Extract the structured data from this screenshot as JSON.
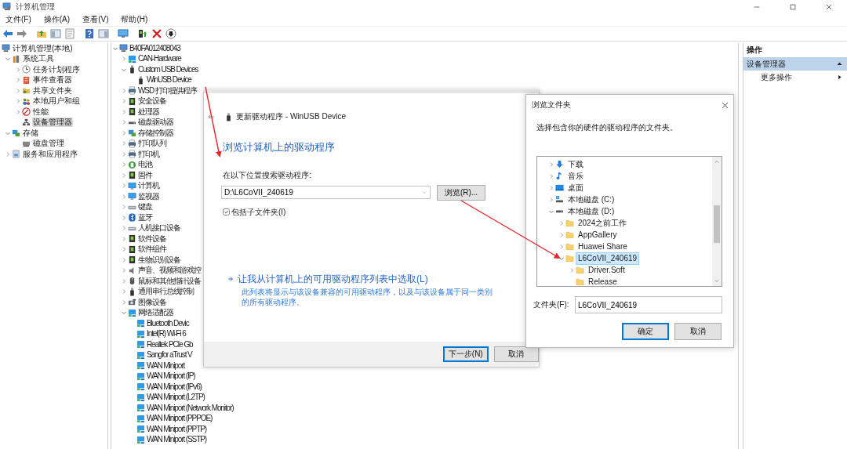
{
  "window": {
    "title": "计算机管理"
  },
  "menu": [
    "文件(F)",
    "操作(A)",
    "查看(V)",
    "帮助(H)"
  ],
  "nav_tree": {
    "label": "计算机管理(本地)",
    "kind": "computer",
    "selected": false,
    "children": [
      {
        "label": "系统工具",
        "kind": "tools",
        "expanded": true,
        "selected": false,
        "children": [
          {
            "label": "任务计划程序",
            "kind": "clock",
            "expanded": false,
            "selected": false
          },
          {
            "label": "事件查看器",
            "kind": "event",
            "expanded": false,
            "selected": false
          },
          {
            "label": "共享文件夹",
            "kind": "share",
            "expanded": false,
            "selected": false
          },
          {
            "label": "本地用户和组",
            "kind": "users",
            "expanded": false,
            "selected": false
          },
          {
            "label": "性能",
            "kind": "perf",
            "expanded": false,
            "selected": false
          },
          {
            "label": "设备管理器",
            "kind": "devmgr",
            "selected": true
          }
        ]
      },
      {
        "label": "存储",
        "kind": "storage",
        "expanded": true,
        "selected": false,
        "children": [
          {
            "label": "磁盘管理",
            "kind": "disk",
            "selected": false
          }
        ]
      },
      {
        "label": "服务和应用程序",
        "kind": "services",
        "expanded": false,
        "selected": false
      }
    ]
  },
  "device_tree": {
    "label": "B40FA012408043",
    "kind": "computer",
    "expanded": true,
    "children": [
      {
        "label": "CAN-Hardware",
        "kind": "network",
        "expanded": false
      },
      {
        "label": "Custom USB Devices",
        "kind": "usb",
        "expanded": true,
        "children": [
          {
            "label": "WinUSB Device",
            "kind": "usb"
          }
        ]
      },
      {
        "label": "WSD 打印提供程序",
        "kind": "printer",
        "expanded": false
      },
      {
        "label": "安全设备",
        "kind": "chip",
        "expanded": false
      },
      {
        "label": "处理器",
        "kind": "chip",
        "expanded": false
      },
      {
        "label": "磁盘驱动器",
        "kind": "drive",
        "expanded": false
      },
      {
        "label": "存储控制器",
        "kind": "storage",
        "expanded": false
      },
      {
        "label": "打印队列",
        "kind": "printer",
        "expanded": false
      },
      {
        "label": "打印机",
        "kind": "printer",
        "expanded": false
      },
      {
        "label": "电池",
        "kind": "battery",
        "expanded": false
      },
      {
        "label": "固件",
        "kind": "chip",
        "expanded": false
      },
      {
        "label": "计算机",
        "kind": "monitor",
        "expanded": false
      },
      {
        "label": "监视器",
        "kind": "monitor",
        "expanded": false
      },
      {
        "label": "键盘",
        "kind": "keyboard",
        "expanded": false
      },
      {
        "label": "蓝牙",
        "kind": "bluetooth",
        "expanded": false
      },
      {
        "label": "人机接口设备",
        "kind": "keyboard",
        "expanded": false
      },
      {
        "label": "软件设备",
        "kind": "chip",
        "expanded": false
      },
      {
        "label": "软件组件",
        "kind": "chip",
        "expanded": false
      },
      {
        "label": "生物识别设备",
        "kind": "chip",
        "expanded": false
      },
      {
        "label": "声音、视频和游戏控",
        "kind": "speaker",
        "expanded": false
      },
      {
        "label": "鼠标和其他指针设备",
        "kind": "mouse",
        "expanded": false
      },
      {
        "label": "通用串行总线控制",
        "kind": "usb",
        "expanded": false
      },
      {
        "label": "图像设备",
        "kind": "camera",
        "expanded": false
      },
      {
        "label": "网络适配器",
        "kind": "network",
        "expanded": true,
        "children": [
          {
            "label": "Bluetooth Devic",
            "kind": "network"
          },
          {
            "label": "Intel(R) Wi-Fi 6",
            "kind": "network"
          },
          {
            "label": "Realtek PCIe Gb",
            "kind": "network"
          },
          {
            "label": "Sangfor aTrust V",
            "kind": "network"
          },
          {
            "label": "WAN Miniport",
            "kind": "network"
          },
          {
            "label": "WAN Miniport (IP)",
            "kind": "network"
          },
          {
            "label": "WAN Miniport (IPv6)",
            "kind": "network"
          },
          {
            "label": "WAN Miniport (L2TP)",
            "kind": "network"
          },
          {
            "label": "WAN Miniport (Network Monitor)",
            "kind": "network"
          },
          {
            "label": "WAN Miniport (PPPOE)",
            "kind": "network"
          },
          {
            "label": "WAN Miniport (PPTP)",
            "kind": "network"
          },
          {
            "label": "WAN Miniport (SSTP)",
            "kind": "network"
          }
        ]
      }
    ]
  },
  "actions_pane": {
    "title": "操作",
    "items": [
      {
        "label": "设备管理器",
        "kind": "section"
      },
      {
        "label": "更多操作",
        "kind": "submenu"
      }
    ]
  },
  "update_dialog": {
    "title": "更新驱动程序 - WinUSB Device",
    "heading": "浏览计算机上的驱动程序",
    "search_label": "在以下位置搜索驱动程序:",
    "path": "D:\\L6CoVII_240619",
    "browse_button": "浏览(R)...",
    "include_subfolders": {
      "label": "包括子文件夹(I)",
      "checked": true
    },
    "pick_link": "让我从计算机上的可用驱动程序列表中选取(L)",
    "pick_description": "此列表将显示与该设备兼容的可用驱动程序，以及与该设备属于同一类别的所有驱动程序。",
    "buttons": [
      "下一步(N)",
      "取消"
    ]
  },
  "browse_dialog": {
    "title": "浏览文件夹",
    "instruction": "选择包含你的硬件的驱动程序的文件夹。",
    "folders": [
      {
        "label": "下载",
        "kind": "download",
        "expanded": false,
        "selected": false
      },
      {
        "label": "音乐",
        "kind": "music",
        "expanded": false,
        "selected": false
      },
      {
        "label": "桌面",
        "kind": "desktop",
        "expanded": false,
        "selected": false
      },
      {
        "label": "本地磁盘 (C:)",
        "kind": "sysdrive",
        "expanded": false,
        "selected": false
      },
      {
        "label": "本地磁盘 (D:)",
        "kind": "drive",
        "expanded": true,
        "selected": false,
        "children": [
          {
            "label": "2024之前工作",
            "kind": "folder",
            "expanded": false,
            "selected": false
          },
          {
            "label": "AppGallery",
            "kind": "folder",
            "expanded": false,
            "selected": false
          },
          {
            "label": "Huawei Share",
            "kind": "folder",
            "expanded": false,
            "selected": false
          },
          {
            "label": "L6CoVII_240619",
            "kind": "folder",
            "expanded": true,
            "selected": true,
            "children": [
              {
                "label": "Driver.Soft",
                "kind": "folder",
                "expanded": false,
                "selected": false
              },
              {
                "label": "Release",
                "kind": "folder",
                "selected": false
              }
            ]
          }
        ]
      }
    ],
    "folder_label": "文件夹(F):",
    "folder_value": "L6CoVII_240619",
    "buttons": [
      "确定",
      "取消"
    ]
  }
}
